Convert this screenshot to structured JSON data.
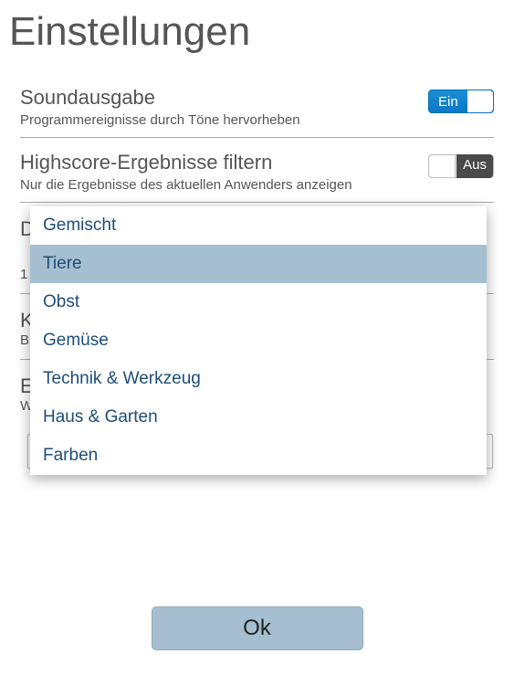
{
  "title": "Einstellungen",
  "settings": {
    "sound": {
      "title": "Soundausgabe",
      "subtitle": "Programmereignisse durch Töne hervorheben",
      "toggle_label": "Ein",
      "state": true
    },
    "highscore": {
      "title": "Highscore-Ergebnisse filtern",
      "subtitle": "Nur die Ergebnisse des aktuellen Anwenders anzeigen",
      "toggle_label": "Aus",
      "state": false
    }
  },
  "obscured_rows": [
    {
      "title_fragment": "D",
      "sub_fragment": "1"
    },
    {
      "title_fragment": "K",
      "sub_fragment": "B"
    },
    {
      "title_fragment": "E",
      "sub_fragment": "W"
    }
  ],
  "dropdown": {
    "options": [
      {
        "label": "Gemischt",
        "selected": false
      },
      {
        "label": "Tiere",
        "selected": true
      },
      {
        "label": "Obst",
        "selected": false
      },
      {
        "label": "Gemüse",
        "selected": false
      },
      {
        "label": "Technik & Werkzeug",
        "selected": false
      },
      {
        "label": "Haus & Garten",
        "selected": false
      },
      {
        "label": "Farben",
        "selected": false
      }
    ]
  },
  "select_field_value": "Tiere",
  "ok_button": "Ok"
}
